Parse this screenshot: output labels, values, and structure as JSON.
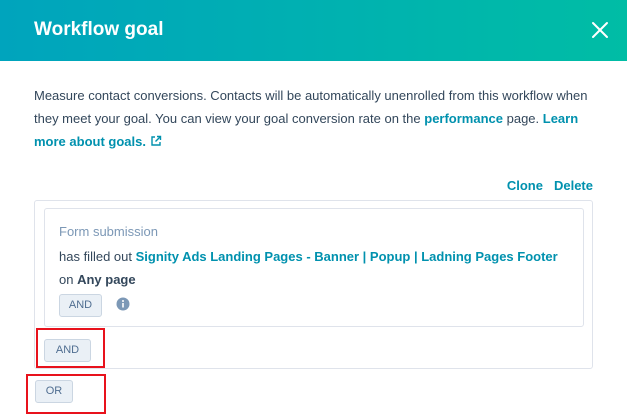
{
  "modal": {
    "title": "Workflow goal",
    "close_icon": "close-icon",
    "header_gradient": [
      "#00a4bd",
      "#00bda5"
    ]
  },
  "description": {
    "text_1": "Measure contact conversions. Contacts will be automatically unenrolled from this workflow when they meet your goal. You can view your goal conversion rate on the ",
    "performance_link": "performance",
    "text_2": " page. ",
    "learn_more_link": "Learn more about goals.",
    "external_icon": "external-link-icon"
  },
  "actions": {
    "clone_label": "Clone",
    "delete_label": "Delete"
  },
  "filter": {
    "type_label": "Form submission",
    "prefix": "has filled out ",
    "form_name": "Signity Ads Landing Pages - Banner | Popup | Ladning Pages Footer",
    "on_label": "on ",
    "page_value": "Any page",
    "and_button": "AND",
    "info_icon": "info-icon"
  },
  "group": {
    "and_button": "AND"
  },
  "or_button": "OR",
  "colors": {
    "accent": "#0091ae",
    "highlight": "#e8121c"
  }
}
